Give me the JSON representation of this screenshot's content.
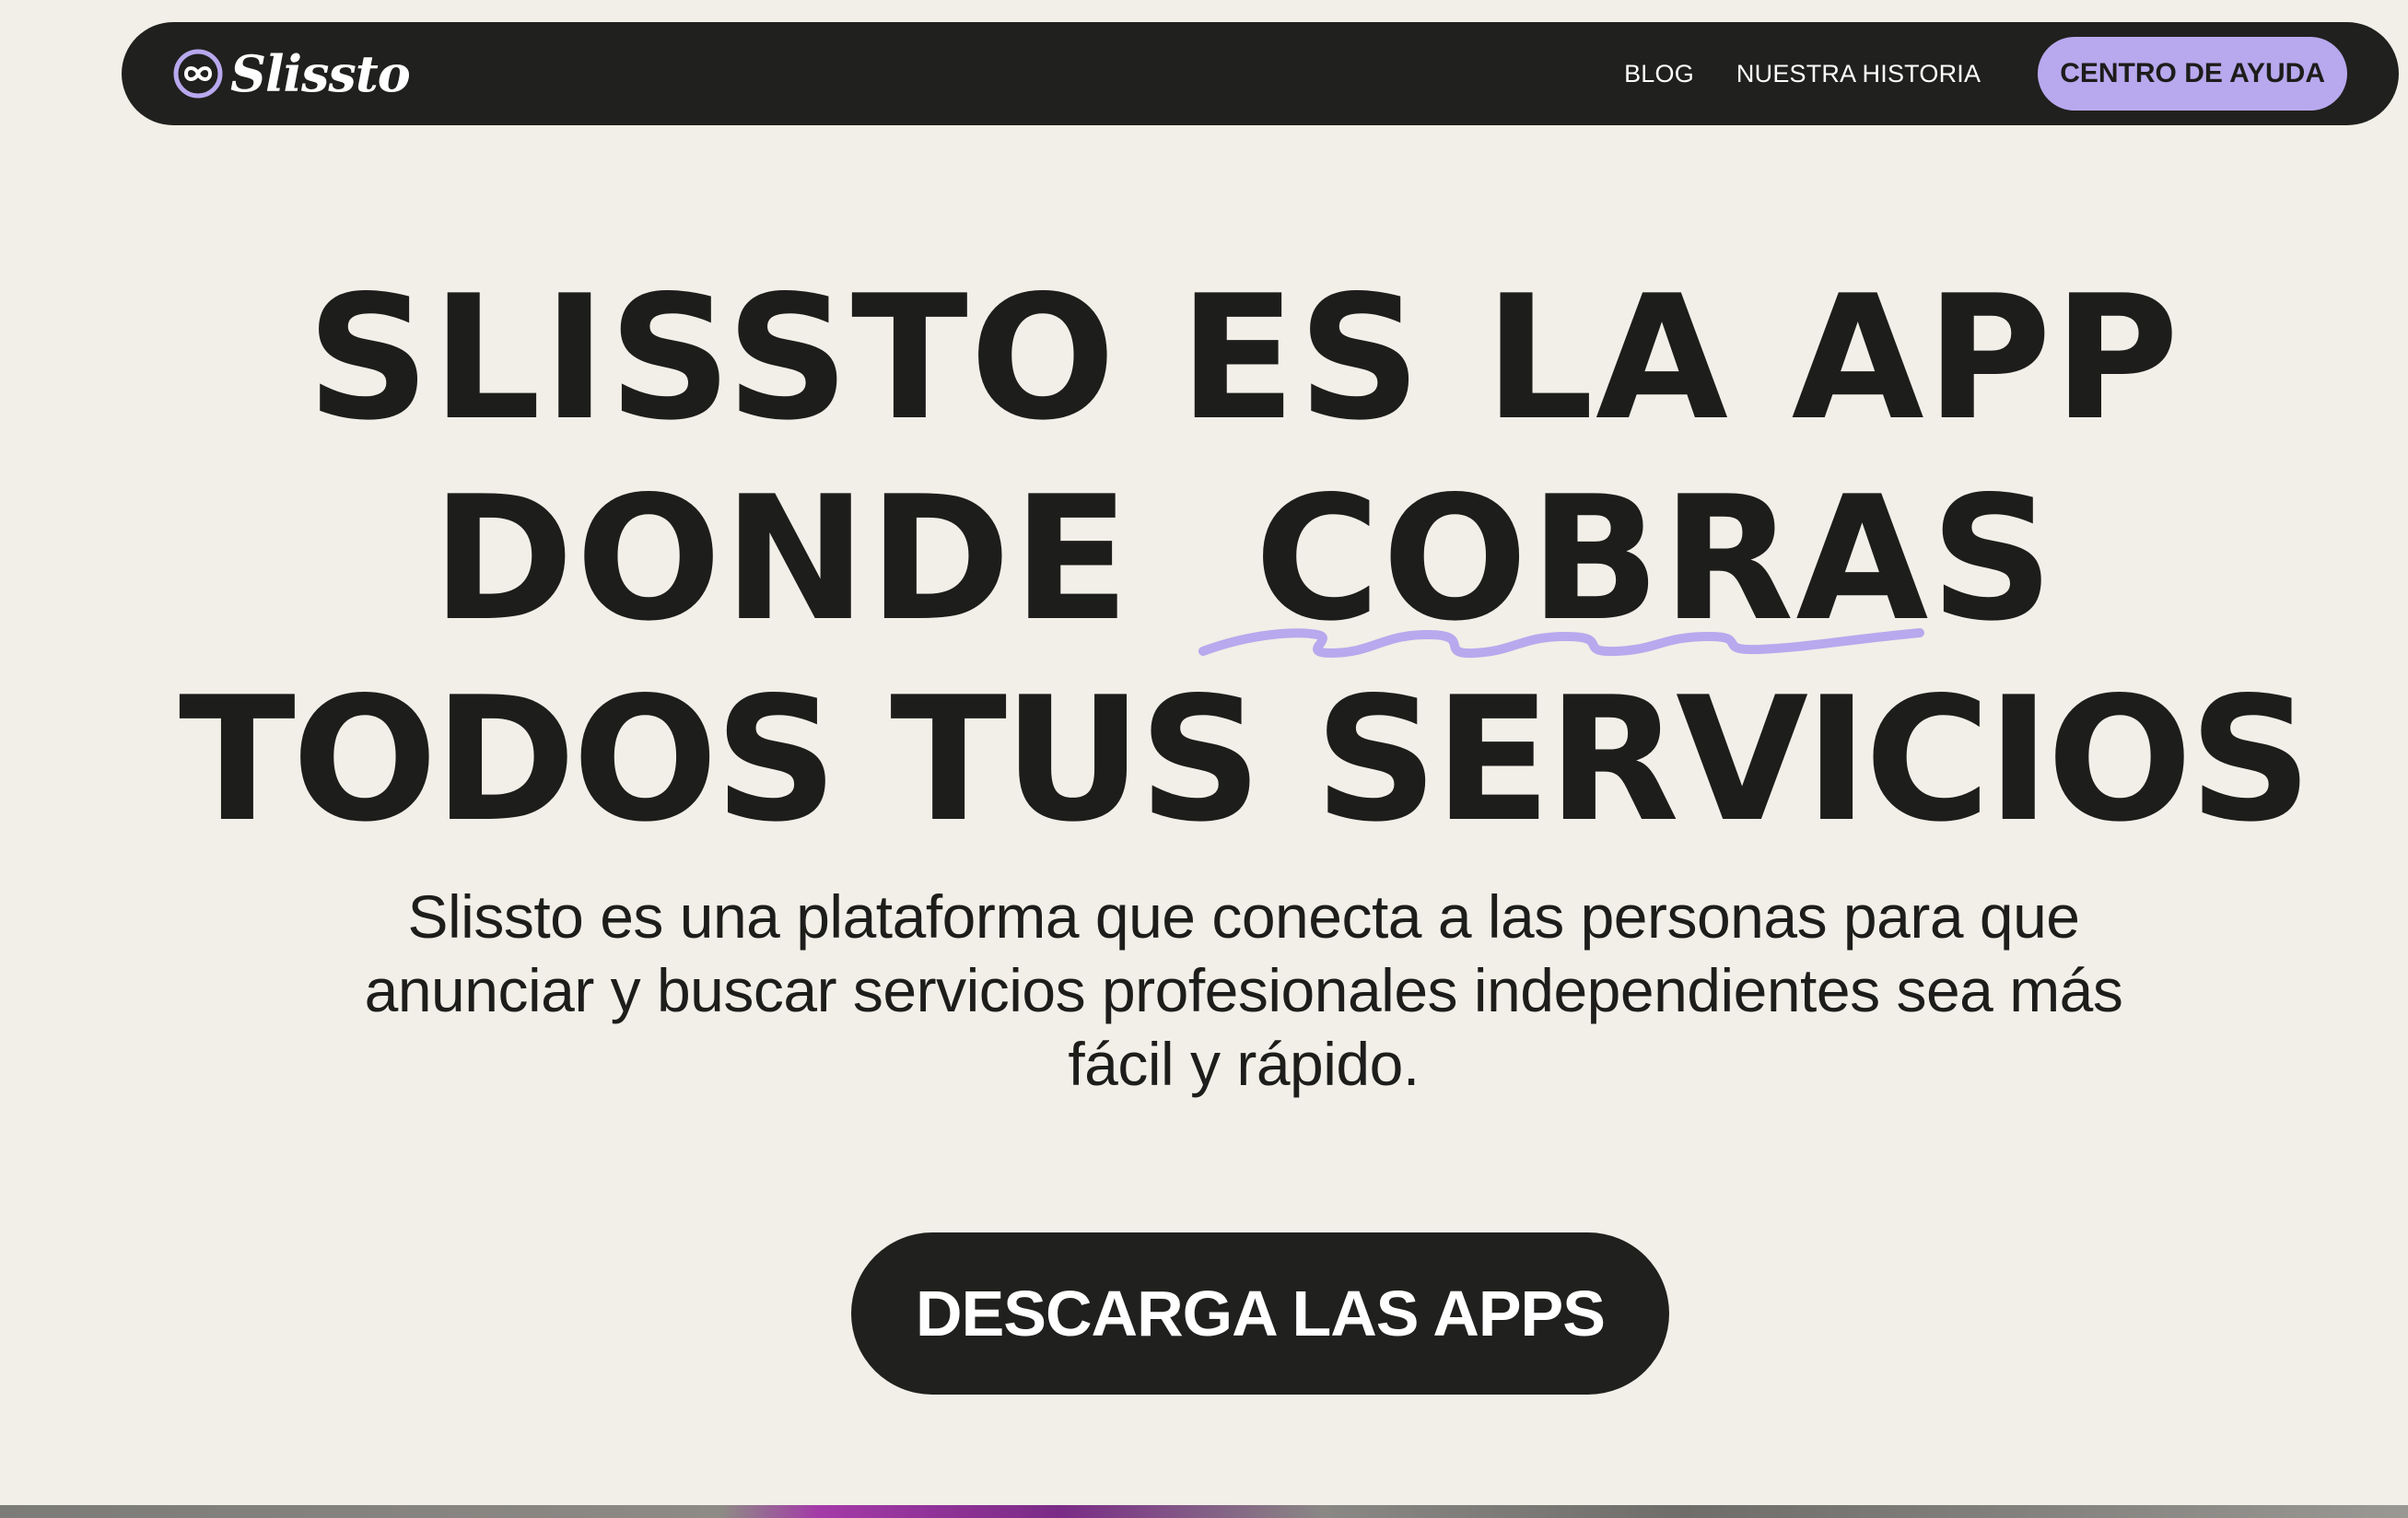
{
  "brand": {
    "name": "Slissto",
    "logo_icon": "infinity-circle-icon"
  },
  "nav": {
    "links": [
      {
        "label": "BLOG"
      },
      {
        "label": "NUESTRA HISTORIA"
      }
    ],
    "cta_label": "CENTRO DE AYUDA"
  },
  "hero": {
    "title_lines": [
      "SLISSTO ES LA APP",
      "DONDE  COBRAS",
      "TODOS TUS SERVICIOS"
    ],
    "subtitle": "Slissto es una plataforma que conecta a las personas para que anunciar y buscar servicios profesionales independientes sea más fácil y rápido.",
    "cta_label": "DESCARGA LAS APPS"
  },
  "colors": {
    "background": "#f1efe7",
    "dark": "#20201e",
    "accent": "#b8a8ee"
  }
}
